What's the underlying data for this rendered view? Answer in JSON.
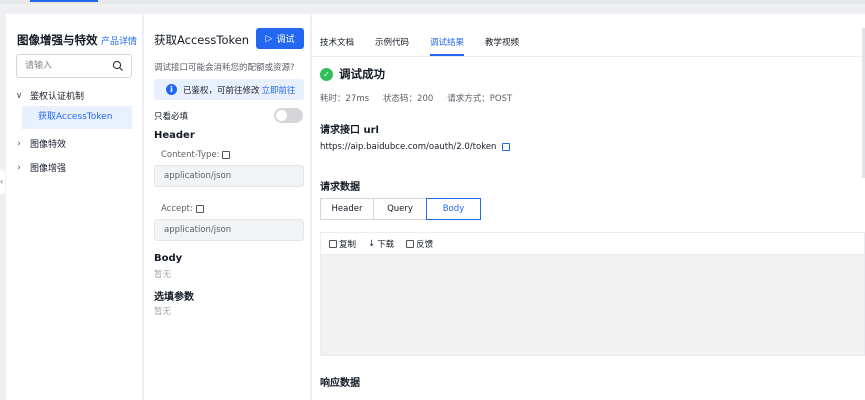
{
  "left": {
    "title": "图像增强与特效",
    "doc_link": "产品详情",
    "search_placeholder": "请输入",
    "tree": [
      {
        "label": "鉴权认证机制",
        "chevron": "∨"
      },
      {
        "label": "获取AccessToken"
      },
      {
        "label": "图像特效",
        "chevron": "›"
      },
      {
        "label": "图像增强",
        "chevron": "›"
      }
    ]
  },
  "middle": {
    "title": "获取AccessToken",
    "debug_button": "调试",
    "note": "调试接口可能会消耗您的配额或资源",
    "alert_text": "已鉴权，可前往修改",
    "alert_link": "立即前往",
    "required_only": "只看必填",
    "header_section": "Header",
    "content_type_label": "Content-Type:",
    "content_type_value": "application/json",
    "accept_label": "Accept:",
    "accept_value": "application/json",
    "body_section": "Body",
    "body_value": "暂无",
    "optional_section": "选填参数",
    "optional_value": "暂无"
  },
  "right": {
    "tabs": [
      "技术文档",
      "示例代码",
      "调试结果",
      "教学视频"
    ],
    "active_tab": 2,
    "success_text": "调试成功",
    "meta": [
      "耗时：27ms",
      "状态码：200",
      "请求方式：POST"
    ],
    "request_url_heading": "请求接口 url",
    "request_url": "https://aip.baidubce.com/oauth/2.0/token",
    "request_data_heading": "请求数据",
    "segments": [
      "Header",
      "Query",
      "Body"
    ],
    "active_segment": 2,
    "toolbar": [
      "复制",
      "下载",
      "反馈"
    ],
    "response_heading": "响应数据"
  }
}
